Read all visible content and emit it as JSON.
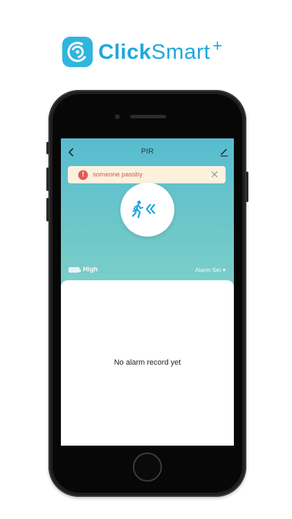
{
  "brand": {
    "name_bold": "Click",
    "name_light": "Smart",
    "superscript": "+",
    "color": "#1fa9da",
    "logo_color": "#2fb6df"
  },
  "device_screen": {
    "title": "PIR",
    "alert": {
      "icon": "exclamation-icon",
      "text": "someone passby",
      "color": "#d9534f",
      "background": "#fbf1dd"
    },
    "sensor_icon": "pir-motion-icon",
    "status": {
      "battery_icon": "battery-icon",
      "sensitivity": "High",
      "alarm_set": "Alarm Set ▾"
    },
    "records": {
      "empty_message": "No alarm record yet"
    },
    "accent": "#1fa9da",
    "gradient_top": "#57bcd0",
    "gradient_bottom": "#7ccfcb"
  }
}
